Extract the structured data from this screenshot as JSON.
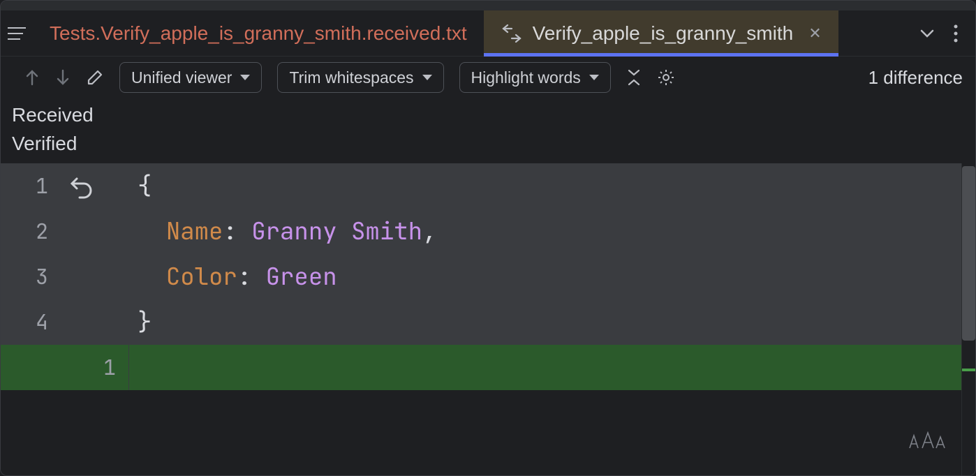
{
  "tabs": {
    "left": {
      "label": "Tests.Verify_apple_is_granny_smith.received.txt"
    },
    "right": {
      "label": "Verify_apple_is_granny_smith"
    }
  },
  "toolbar": {
    "viewer_mode": "Unified viewer",
    "whitespace": "Trim whitespaces",
    "highlight": "Highlight words",
    "diff_count": "1 difference"
  },
  "panel_labels": {
    "received": "Received",
    "verified": "Verified"
  },
  "code": {
    "l1": {
      "num": "1",
      "brace": "{"
    },
    "l2": {
      "num": "2",
      "key": "Name",
      "colon": ":",
      "val": "Granny Smith",
      "comma": ","
    },
    "l3": {
      "num": "3",
      "key": "Color",
      "colon": ":",
      "val": "Green"
    },
    "l4": {
      "num": "4",
      "brace": "}"
    },
    "v1": {
      "num": "1"
    }
  }
}
